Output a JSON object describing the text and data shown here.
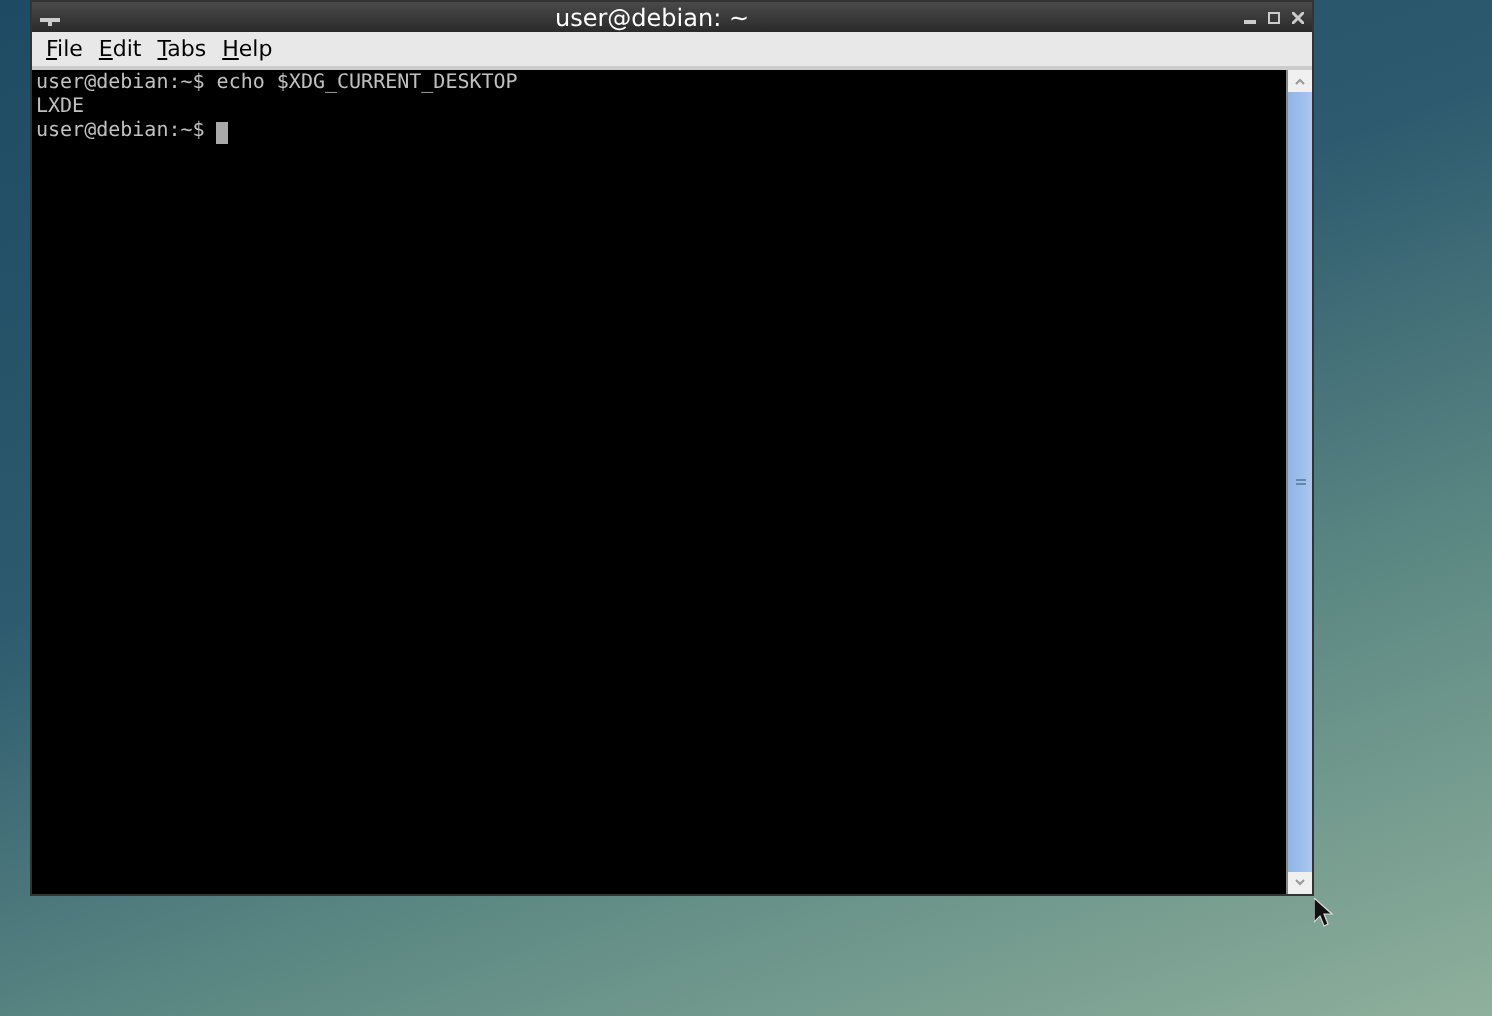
{
  "window": {
    "title": "user@debian: ~"
  },
  "menu": [
    {
      "label": "File"
    },
    {
      "label": "Edit"
    },
    {
      "label": "Tabs"
    },
    {
      "label": "Help"
    }
  ],
  "terminal": {
    "lines": [
      "user@debian:~$ echo $XDG_CURRENT_DESKTOP",
      "LXDE",
      "user@debian:~$"
    ]
  }
}
